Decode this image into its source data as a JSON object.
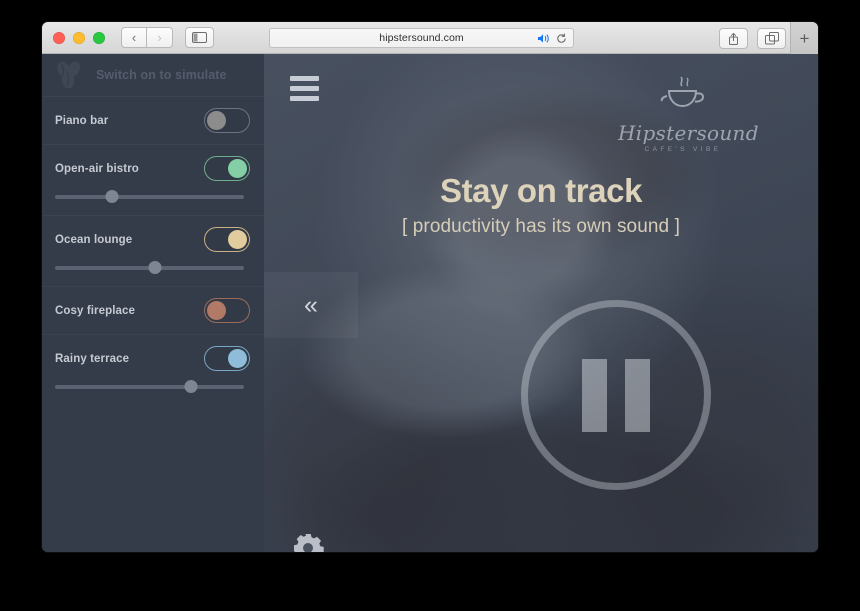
{
  "browser": {
    "traffic_lights": [
      "close",
      "minimize",
      "zoom"
    ],
    "back_label": "‹",
    "forward_label": "›",
    "sidebar_toggle_icon": "sidebar-icon",
    "url": "hipstersound.com",
    "speaker_icon": "speaker-icon",
    "reload_icon": "reload-icon",
    "share_icon": "share-icon",
    "tabs_icon": "tabs-icon",
    "new_tab_label": "+"
  },
  "sidebar": {
    "logo_icon": "coffee-beans-icon",
    "header_text": "Switch on to simulate",
    "sounds": [
      {
        "label": "Piano bar",
        "on": false,
        "knob_color": "#8c8c8c",
        "border_color": "#6b7483",
        "has_slider": false,
        "volume": 0
      },
      {
        "label": "Open-air bistro",
        "on": true,
        "knob_color": "#85cfa6",
        "border_color": "#6fae8c",
        "has_slider": true,
        "volume": 30
      },
      {
        "label": "Ocean lounge",
        "on": true,
        "knob_color": "#e2cb9c",
        "border_color": "#c8b185",
        "has_slider": true,
        "volume": 53
      },
      {
        "label": "Cosy fireplace",
        "on": false,
        "knob_color": "#b07a67",
        "border_color": "#9c6c5a",
        "has_slider": false,
        "volume": 0
      },
      {
        "label": "Rainy terrace",
        "on": true,
        "knob_color": "#8fbcd8",
        "border_color": "#7aa7c4",
        "has_slider": true,
        "volume": 72
      }
    ]
  },
  "hero": {
    "menu_icon": "hamburger-menu-icon",
    "logo_word": "Hipstersound",
    "logo_tagline": "CAFE'S VIBE",
    "title": "Stay on track",
    "subtitle": "[ productivity has its own sound ]",
    "collapse_icon": "«",
    "player_state": "pause",
    "settings_icon": "gear-icon"
  },
  "colors": {
    "sidebar_bg": "#343b49",
    "divider": "#3b4251",
    "hero_title": "#ddd3bb",
    "accent_green": "#85cfa6",
    "accent_tan": "#e2cb9c",
    "accent_brown": "#b07a67",
    "accent_blue": "#8fbcd8"
  }
}
